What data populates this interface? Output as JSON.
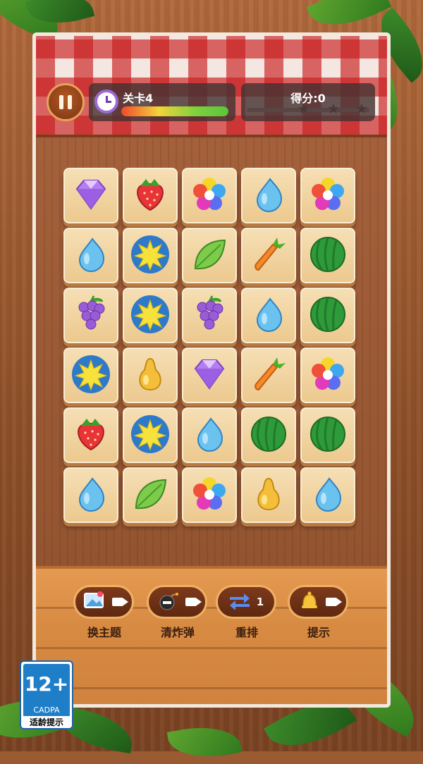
{
  "hud": {
    "level_label": "关卡4",
    "level_progress": 1.0,
    "score_label": "得分:0",
    "score_stars_earned": 0,
    "score_stars_total": 3
  },
  "board": {
    "rows": [
      [
        "diamond",
        "strawberry",
        "flower",
        "water-drop",
        "flower"
      ],
      [
        "water-drop",
        "sun",
        "leaf",
        "carrot",
        "watermelon"
      ],
      [
        "grapes",
        "sun",
        "grapes",
        "water-drop",
        "watermelon"
      ],
      [
        "sun",
        "pear",
        "diamond",
        "carrot",
        "flower"
      ],
      [
        "strawberry",
        "sun",
        "water-drop",
        "watermelon",
        "watermelon"
      ],
      [
        "water-drop",
        "leaf",
        "flower",
        "pear",
        "water-drop"
      ]
    ]
  },
  "tools": [
    {
      "id": "theme",
      "label": "换主题",
      "icon": "picture-icon",
      "badge": "video-icon"
    },
    {
      "id": "bomb",
      "label": "清炸弹",
      "icon": "bomb-icon",
      "badge": "video-icon"
    },
    {
      "id": "shuffle",
      "label": "重排",
      "icon": "shuffle-icon",
      "count": "1"
    },
    {
      "id": "hint",
      "label": "提示",
      "icon": "bell-icon",
      "badge": "video-icon"
    }
  ],
  "age_rating": {
    "age": "12+",
    "org": "CADPA",
    "note": "适龄提示"
  }
}
